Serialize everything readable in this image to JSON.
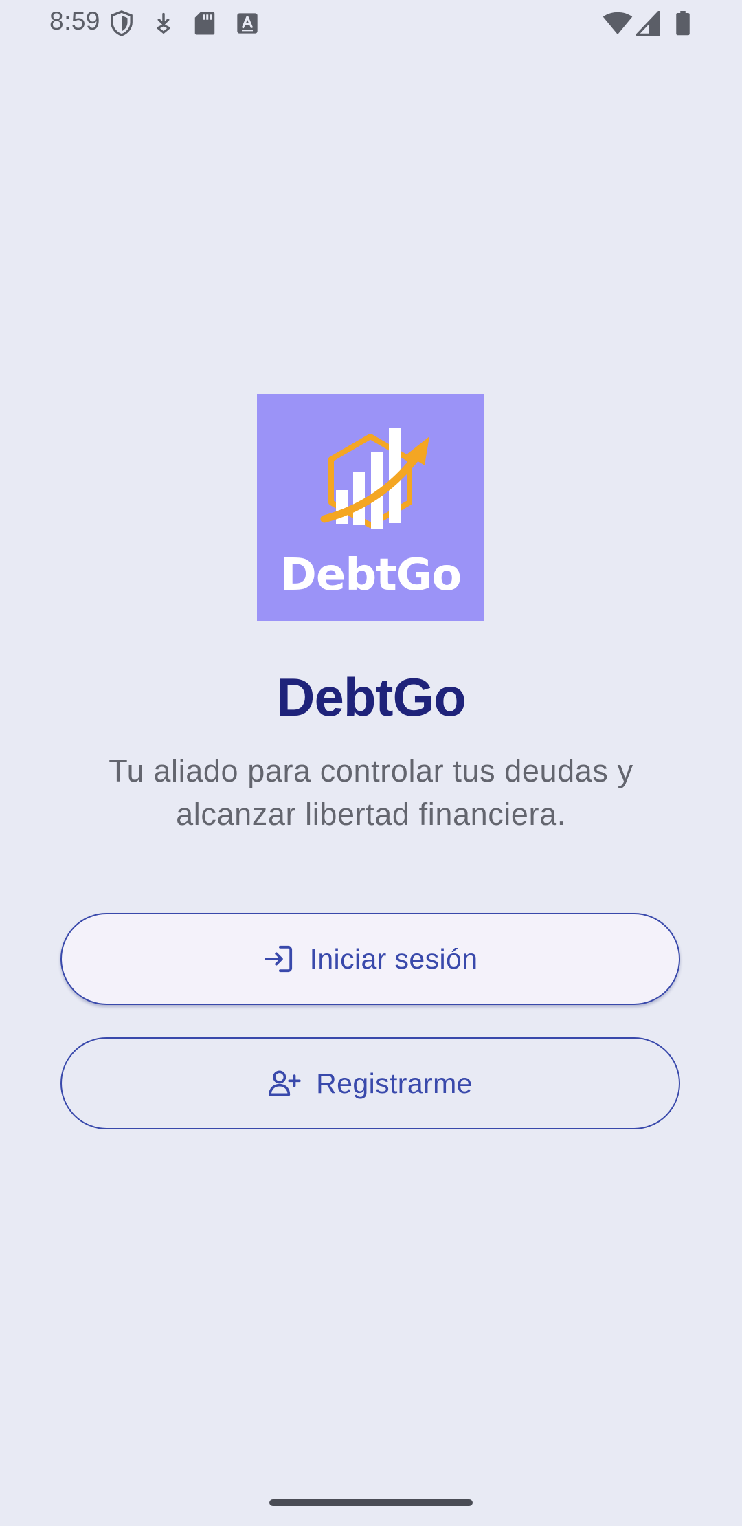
{
  "status_bar": {
    "time": "8:59",
    "left_icons": [
      "shield-icon",
      "download-icon",
      "sd-card-icon",
      "keyboard-a-icon"
    ],
    "right_icons": [
      "wifi-icon",
      "cellular-signal-icon",
      "battery-icon"
    ]
  },
  "logo": {
    "wordmark": "DebtGo",
    "background_color": "#9b93f7",
    "accent_color": "#f4a623"
  },
  "app": {
    "title": "DebtGo",
    "subtitle": "Tu aliado para controlar tus deudas y alcanzar libertad financiera."
  },
  "actions": {
    "login_label": "Iniciar sesión",
    "login_icon": "login-arrow-icon",
    "register_label": "Registrarme",
    "register_icon": "person-add-icon"
  },
  "colors": {
    "background": "#e8eaf4",
    "primary": "#3949ab",
    "title": "#1f237a"
  }
}
